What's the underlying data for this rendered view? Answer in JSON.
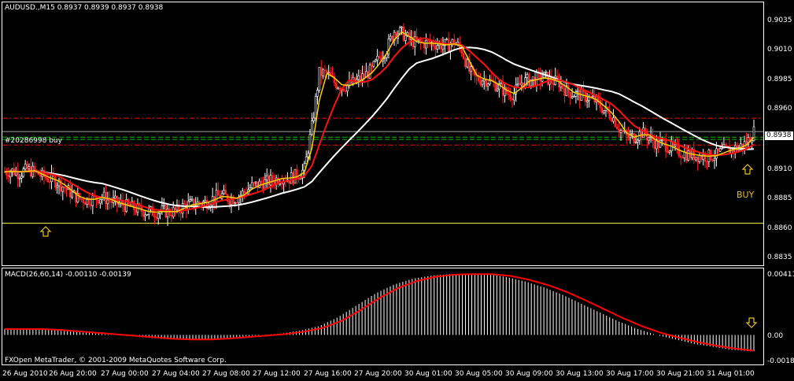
{
  "window": {
    "symbol_info": "AUDUSD.,M15  0.8937 0.8939 0.8937 0.8938",
    "indicator_info": "MACD(26,60,14) -0.00110 -0.00139",
    "copyright": "FXOpen MetaTrader, © 2001-2009 MetaQuotes Software Corp.",
    "order_label": "#20286998 buy",
    "buy_label": "BUY",
    "current_price": "0.8938"
  },
  "price_axis": {
    "ticks": [
      "0.9035",
      "0.9010",
      "0.8985",
      "0.8960",
      "0.8910",
      "0.8885",
      "0.8860",
      "0.8835"
    ]
  },
  "macd_axis": {
    "ticks": [
      "0.00411",
      "0.00",
      "-0.00183"
    ]
  },
  "time_axis": {
    "ticks": [
      "26 Aug 2010",
      "26 Aug 20:00",
      "27 Aug 00:00",
      "27 Aug 04:00",
      "27 Aug 08:00",
      "27 Aug 12:00",
      "27 Aug 16:00",
      "27 Aug 20:00",
      "30 Aug 01:00",
      "30 Aug 05:00",
      "30 Aug 09:00",
      "30 Aug 13:00",
      "30 Aug 17:00",
      "30 Aug 21:00",
      "31 Aug 01:00"
    ]
  },
  "colors": {
    "background": "#000000",
    "bull_candle": "#ffffff",
    "bear_candle": "#ff2020",
    "ma_fast": "#ffd000",
    "ma_mid": "#ff1010",
    "ma_slow": "#ffffff",
    "order_line": "#00c000",
    "stop_line": "#ff0000",
    "support_line": "#ffff40",
    "macd_hist": "#ffffff",
    "macd_signal": "#ff0000",
    "arrow": "#e8c020"
  },
  "chart_data": {
    "type": "candlestick",
    "symbol": "AUDUSD.",
    "timeframe": "M15",
    "ohlc": {
      "open": 0.8937,
      "high": 0.8939,
      "low": 0.8937,
      "close": 0.8938
    },
    "price_range": [
      0.8822,
      0.905
    ],
    "horizontal_lines": {
      "order_buy": 0.8938,
      "red_dashed_upper": 0.895,
      "red_dashed_lower": 0.8926,
      "green_dashed_1": 0.8933,
      "green_dashed_2": 0.8931,
      "yellow_support": 0.8856
    },
    "close_series": [
      0.8902,
      0.8903,
      0.8901,
      0.8904,
      0.8902,
      0.8898,
      0.8896,
      0.8893,
      0.8888,
      0.8882,
      0.8878,
      0.8877,
      0.8878,
      0.888,
      0.8876,
      0.8874,
      0.8872,
      0.887,
      0.8868,
      0.8866,
      0.8866,
      0.8867,
      0.8866,
      0.8867,
      0.8872,
      0.8873,
      0.8874,
      0.8875,
      0.8879,
      0.8881,
      0.8878,
      0.8879,
      0.8884,
      0.8889,
      0.8891,
      0.8893,
      0.8895,
      0.8897,
      0.8896,
      0.8899,
      0.8904,
      0.8942,
      0.899,
      0.899,
      0.8982,
      0.8978,
      0.898,
      0.8983,
      0.8988,
      0.8993,
      0.9004,
      0.9012,
      0.9028,
      0.9026,
      0.902,
      0.9017,
      0.9017,
      0.9017,
      0.9016,
      0.9015,
      0.9018,
      0.9011,
      0.8992,
      0.8985,
      0.8985,
      0.8982,
      0.8978,
      0.8972,
      0.8972,
      0.8982,
      0.8984,
      0.8985,
      0.8987,
      0.8983,
      0.8982,
      0.8974,
      0.8972,
      0.897,
      0.8968,
      0.8965,
      0.8957,
      0.8953,
      0.8941,
      0.8933,
      0.8933,
      0.8937,
      0.8933,
      0.8927,
      0.8927,
      0.8923,
      0.892,
      0.8918,
      0.8917,
      0.8916,
      0.8916,
      0.8917,
      0.8921,
      0.8922,
      0.8924,
      0.8928,
      0.8938
    ],
    "macd_series": [
      0.0004,
      0.0004,
      0.0003,
      0.0002,
      0.0001,
      0.0,
      -0.0001,
      -0.0002,
      -0.0003,
      -0.0003,
      -0.0003,
      -0.0002,
      -0.0001,
      0.0,
      0.0001,
      0.0003,
      0.0006,
      0.0012,
      0.002,
      0.0028,
      0.0034,
      0.0038,
      0.004,
      0.0041,
      0.0041,
      0.0041,
      0.0039,
      0.0036,
      0.0032,
      0.0027,
      0.0021,
      0.0015,
      0.0009,
      0.0004,
      0.0,
      -0.0003,
      -0.0006,
      -0.0008,
      -0.001,
      -0.0011,
      -0.0011
    ],
    "macd_range": [
      -0.00183,
      0.00411
    ]
  }
}
